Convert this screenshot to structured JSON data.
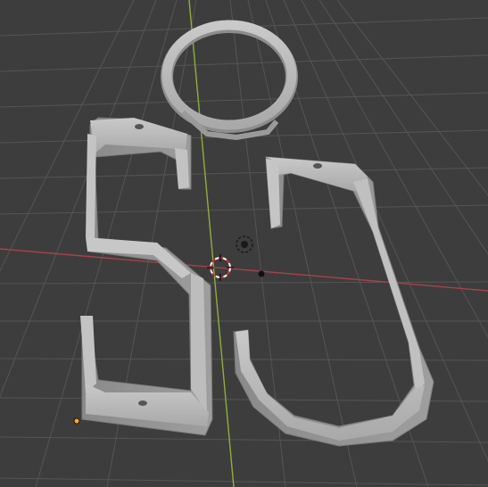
{
  "viewport": {
    "background_color": "#3d3d3d",
    "grid_color": "#555555",
    "x_axis_color": "#a8414c",
    "y_axis_color": "#8fae3a"
  },
  "objects": [
    {
      "name": "ring",
      "color": "#b4b4b4"
    },
    {
      "name": "s-shaped-hook",
      "color": "#b4b4b4"
    },
    {
      "name": "j-shaped-hook",
      "color": "#b4b4b4"
    }
  ],
  "gizmos": {
    "origin_icon": "origin-icon",
    "3d-cursor_icon": "3d-cursor-icon",
    "camera_dot_icon": "view-dot-icon",
    "selected_origin_color": "#f5a623"
  }
}
